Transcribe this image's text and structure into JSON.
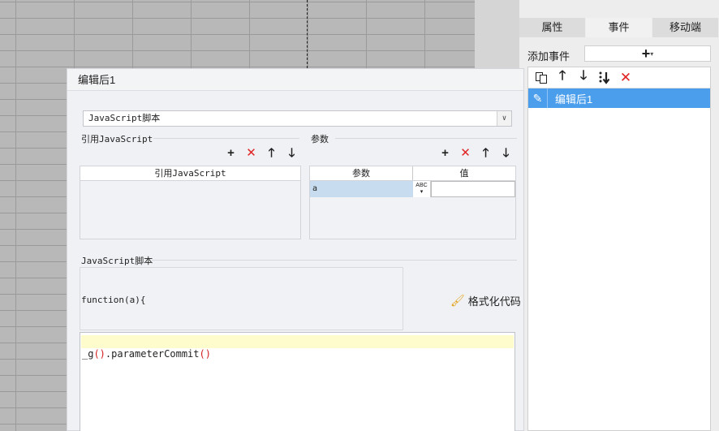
{
  "right_panel": {
    "tabs": [
      "属性",
      "事件",
      "移动端"
    ],
    "active_tab": "事件",
    "add_event_label": "添加事件",
    "add_event_plus": "+",
    "toolbar_icons": [
      "copy-icon",
      "arrow-up-icon",
      "arrow-down-icon",
      "sort-down-icon",
      "delete-icon"
    ],
    "events": [
      {
        "label": "编辑后1"
      }
    ]
  },
  "dialog": {
    "title": "编辑后1",
    "script_type": "JavaScript脚本",
    "ref_section": {
      "title": "引用JavaScript",
      "column": "引用JavaScript"
    },
    "param_section": {
      "title": "参数",
      "columns": [
        "参数",
        "值"
      ],
      "rows": [
        {
          "name": "a",
          "type_badge": "ABC",
          "value": ""
        }
      ]
    },
    "script_section": {
      "title": "JavaScript脚本",
      "function_header": "function(a){",
      "format_label": "格式化代码",
      "code_prefix": "_g",
      "code_open": "()",
      "code_mid": ".parameterCommit",
      "code_close": "()"
    }
  },
  "colors": {
    "selected_event_bg": "#4a9eeb",
    "delete_red": "#e02424",
    "code_highlight": "#fefccc"
  }
}
